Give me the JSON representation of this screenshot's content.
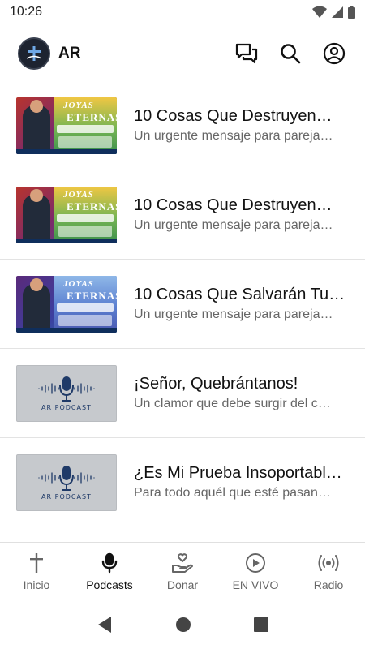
{
  "status": {
    "time": "10:26"
  },
  "header": {
    "title": "AR"
  },
  "episodes": [
    {
      "title": "10 Cosas Que Destruyen…",
      "subtitle": "Un urgente mensaje para pareja…",
      "thumb_type": "video"
    },
    {
      "title": "10 Cosas Que Destruyen…",
      "subtitle": "Un urgente mensaje para pareja…",
      "thumb_type": "video"
    },
    {
      "title": "10 Cosas Que Salvarán Tu…",
      "subtitle": "Un urgente mensaje para pareja…",
      "thumb_type": "video"
    },
    {
      "title": "¡Señor, Quebrántanos!",
      "subtitle": "Un clamor que debe surgir del c…",
      "thumb_type": "podcast"
    },
    {
      "title": "¿Es Mi Prueba Insoportabl…",
      "subtitle": "Para todo aquél que esté pasan…",
      "thumb_type": "podcast"
    }
  ],
  "thumbs": {
    "series_word1": "JOYAS",
    "series_word2": "ETERNAS",
    "podcast_label": "AR PODCAST"
  },
  "nav": [
    {
      "label": "Inicio",
      "icon": "cross-icon"
    },
    {
      "label": "Podcasts",
      "icon": "microphone-icon",
      "active": true
    },
    {
      "label": "Donar",
      "icon": "donate-hand-heart-icon"
    },
    {
      "label": "EN VIVO",
      "icon": "play-circle-icon"
    },
    {
      "label": "Radio",
      "icon": "radio-broadcast-icon"
    }
  ],
  "colors": {
    "accent": "#111111",
    "muted": "#666666",
    "divider": "#e3e3e3",
    "podcast_bg": "#c6c9cd",
    "podcast_ink": "#1f3a68"
  }
}
